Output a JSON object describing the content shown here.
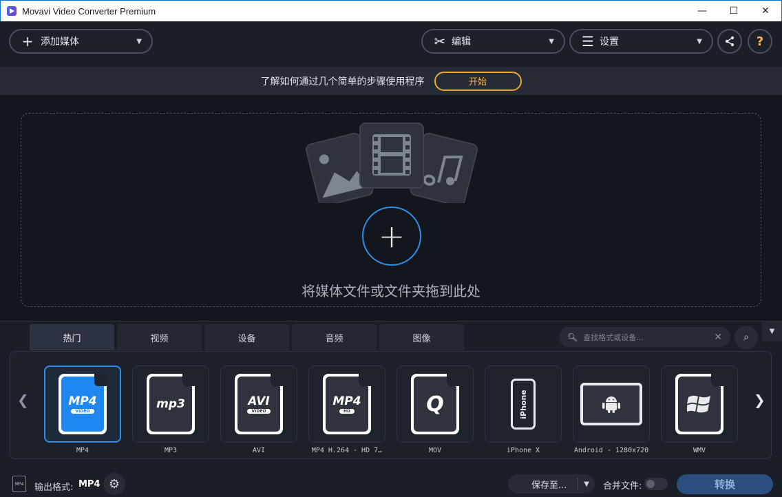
{
  "window": {
    "title": "Movavi Video Converter Premium",
    "controls": [
      "—",
      "☐",
      "✕"
    ]
  },
  "toolbar": {
    "add_media_label": "添加媒体",
    "edit_label": "编辑",
    "settings_label": "设置"
  },
  "banner": {
    "text": "了解如何通过几个简单的步骤使用程序",
    "start_label": "开始"
  },
  "droparea": {
    "hint": "将媒体文件或文件夹拖到此处"
  },
  "tabs": [
    {
      "label": "热门",
      "active": true
    },
    {
      "label": "视频",
      "active": false
    },
    {
      "label": "设备",
      "active": false
    },
    {
      "label": "音频",
      "active": false
    },
    {
      "label": "图像",
      "active": false
    }
  ],
  "search": {
    "placeholder": "查找格式或设备..."
  },
  "formats": [
    {
      "label": "MP4",
      "icon": "MP4",
      "sub": "VIDEO",
      "selected": true
    },
    {
      "label": "MP3",
      "icon": "mp3",
      "sub": "",
      "selected": false
    },
    {
      "label": "AVI",
      "icon": "AVI",
      "sub": "VIDEO",
      "selected": false
    },
    {
      "label": "MP4 H.264 - HD 7…",
      "icon": "MP4",
      "sub": "HD",
      "selected": false
    },
    {
      "label": "MOV",
      "icon": "Q",
      "sub": "",
      "selected": false
    },
    {
      "label": "iPhone X",
      "icon": "iPhone",
      "sub": "",
      "selected": false
    },
    {
      "label": "Android - 1280x720",
      "icon": "android",
      "sub": "",
      "selected": false
    },
    {
      "label": "WMV",
      "icon": "windows",
      "sub": "",
      "selected": false
    }
  ],
  "footer": {
    "output_format_label": "输出格式:",
    "output_format_value": "MP4",
    "output_icon_text": "MP4",
    "save_label": "保存至...",
    "merge_label": "合并文件:",
    "merge_on": false,
    "convert_label": "转换"
  },
  "colors": {
    "accent": "#2a8cf0",
    "start_button": "#e8a83a",
    "convert_button": "#2a4f7e"
  }
}
